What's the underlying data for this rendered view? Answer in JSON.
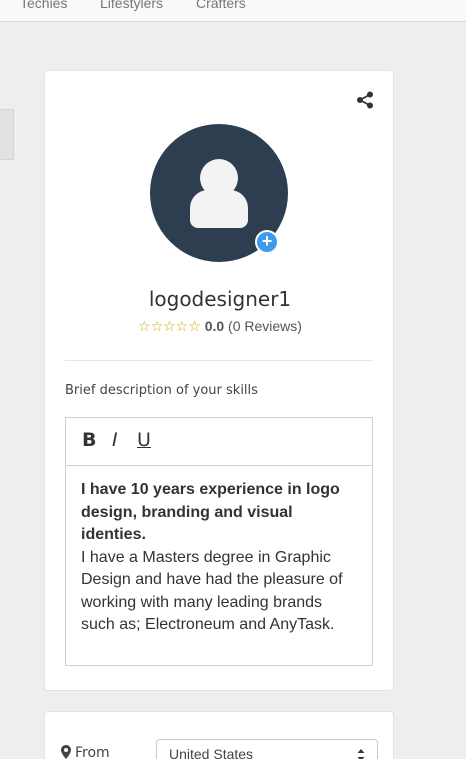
{
  "nav": {
    "items": [
      "Techies",
      "Lifestylers",
      "Crafters"
    ]
  },
  "profile": {
    "username": "logodesigner1",
    "rating_value": "0.0",
    "reviews_text": "(0 Reviews)",
    "star_count": 5,
    "rating_fraction": 0,
    "share_icon": "share-icon",
    "add_photo_icon": "plus-icon",
    "add_photo_symbol": "+"
  },
  "skills": {
    "label": "Brief description of your skills",
    "toolbar": {
      "bold": "B",
      "italic": "I",
      "underline": "U"
    },
    "content": {
      "bold_paragraph": "I have 10 years experience in logo design, branding and visual identies.",
      "paragraph": "I have a Masters degree in Graphic Design and have had the pleasure of working with many leading brands such as; Electroneum and AnyTask."
    }
  },
  "location": {
    "from_label": "From",
    "country": "United States"
  },
  "colors": {
    "avatar_bg": "#2c3e50",
    "accent": "#3d9be9",
    "star": "#d4a800",
    "page_bg": "#eeeeee"
  }
}
